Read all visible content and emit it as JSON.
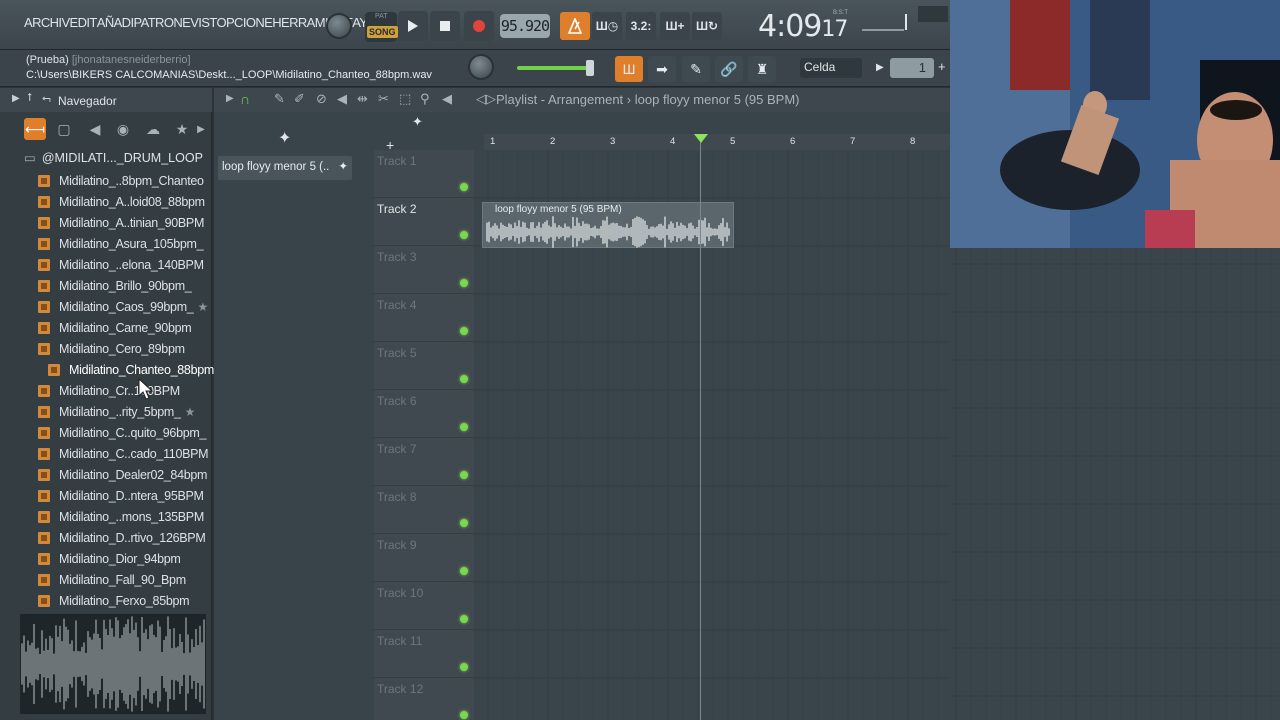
{
  "menu": {
    "items": [
      "ARCHIV",
      "EDIT",
      "AÑADI",
      "PATRON",
      "EVISTO",
      "PCIONE",
      "HERRAMIENT",
      "AY"
    ]
  },
  "transport": {
    "pat_label": "PAT",
    "song_label": "SONG",
    "bpm": "95.920",
    "time": "4:09",
    "time_fraction": "17",
    "time_label": "B:S:T"
  },
  "hint": {
    "title": "(Prueba)",
    "user": "[jhonatanesneiderberrio]",
    "path": "C:\\Users\\BIKERS CALCOMANIAS\\Deskt..._LOOP\\Midilatino_Chanteo_88bpm.wav"
  },
  "snap": {
    "value": "Celda"
  },
  "pattern_number": "1",
  "browser": {
    "title": "Navegador",
    "folder": "@MIDILATI..._DRUM_LOOP",
    "files": [
      "Midilatino_..8bpm_Chanteo",
      "Midilatino_A..loid08_88bpm",
      "Midilatino_A..tinian_90BPM",
      "Midilatino_Asura_105bpm_",
      "Midilatino_..elona_140BPM",
      "Midilatino_Brillo_90bpm_",
      "Midilatino_Caos_99bpm_",
      "Midilatino_Carne_90bpm",
      "Midilatino_Cero_89bpm",
      "Midilatino_Chanteo_88bpm",
      "Midilatino_Cr..170BPM",
      "Midilatino_..rity_5bpm_",
      "Midilatino_C..quito_96bpm_",
      "Midilatino_C..cado_110BPM",
      "Midilatino_Dealer02_84bpm",
      "Midilatino_D..ntera_95BPM",
      "Midilatino_..mons_135BPM",
      "Midilatino_D..rtivo_126BPM",
      "Midilatino_Dior_94bpm",
      "Midilatino_Fall_90_Bpm",
      "Midilatino_Ferxo_85bpm"
    ]
  },
  "playlist": {
    "title": "Playlist - Arrangement",
    "separator": "›",
    "pattern": "loop floyy menor 5 (95 BPM)",
    "pattern_short": "loop floyy menor 5 (..",
    "clip_label": "loop floyy menor 5 (95 BPM)",
    "tracks": [
      "Track 1",
      "Track 2",
      "Track 3",
      "Track 4",
      "Track 5",
      "Track 6",
      "Track 7",
      "Track 8",
      "Track 9",
      "Track 10",
      "Track 11",
      "Track 12"
    ],
    "ruler": [
      "1",
      "2",
      "3",
      "4",
      "5",
      "6",
      "7",
      "8"
    ]
  },
  "colors": {
    "accent": "#e07f2b",
    "led": "#7bd84d",
    "record": "#e0443a",
    "background": "#3a454b"
  }
}
